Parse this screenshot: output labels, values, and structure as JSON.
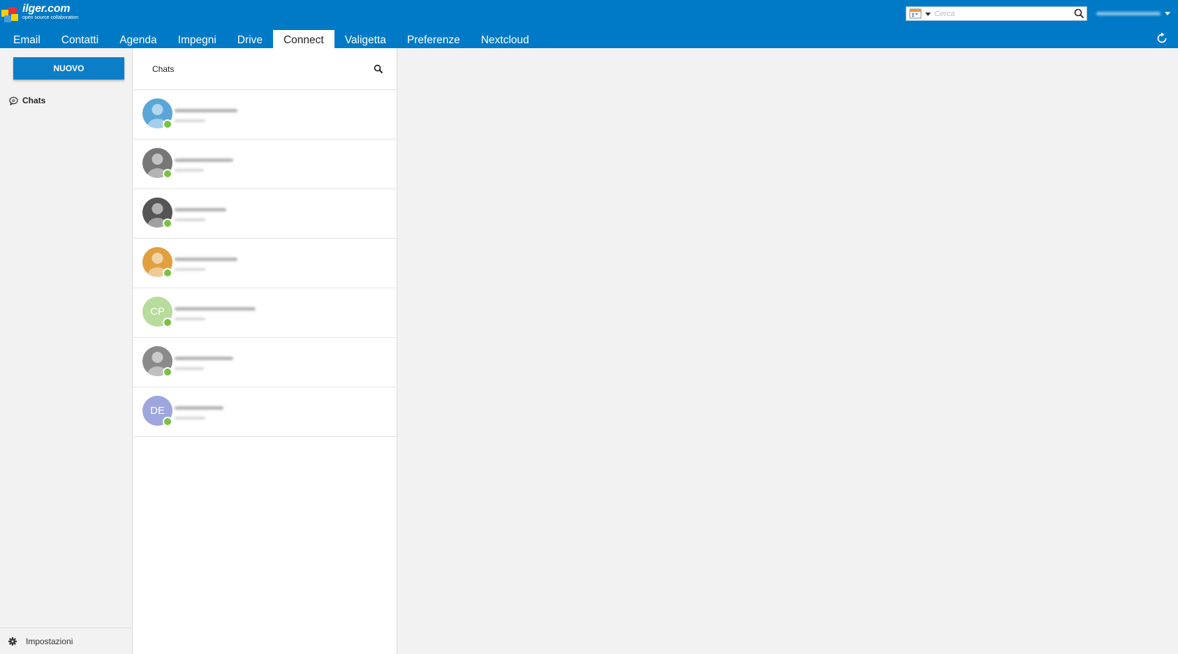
{
  "brand": {
    "name": "ilger.com",
    "tagline": "open source collaboration"
  },
  "search": {
    "placeholder": "Cerca"
  },
  "nav": {
    "tabs": [
      {
        "label": "Email",
        "active": false
      },
      {
        "label": "Contatti",
        "active": false
      },
      {
        "label": "Agenda",
        "active": false
      },
      {
        "label": "Impegni",
        "active": false
      },
      {
        "label": "Drive",
        "active": false
      },
      {
        "label": "Connect",
        "active": true
      },
      {
        "label": "Valigetta",
        "active": false
      },
      {
        "label": "Preferenze",
        "active": false
      },
      {
        "label": "Nextcloud",
        "active": false
      }
    ]
  },
  "sidebar": {
    "new_button": "NUOVO",
    "items": [
      {
        "label": "Chats",
        "icon": "chat-icon"
      }
    ],
    "settings_label": "Impostazioni"
  },
  "chat_list": {
    "title": "Chats",
    "rows": [
      {
        "avatar_type": "photo",
        "avatar_color": "#5aa6d8",
        "status": "online"
      },
      {
        "avatar_type": "photo",
        "avatar_color": "#777777",
        "status": "online"
      },
      {
        "avatar_type": "photo",
        "avatar_color": "#555555",
        "status": "online"
      },
      {
        "avatar_type": "photo",
        "avatar_color": "#e0a040",
        "status": "online"
      },
      {
        "avatar_type": "initials",
        "initials": "CP",
        "avatar_color": "#b8dc9c",
        "status": "online"
      },
      {
        "avatar_type": "photo",
        "avatar_color": "#8a8a8a",
        "status": "online"
      },
      {
        "avatar_type": "initials",
        "initials": "DE",
        "avatar_color": "#9ea6de",
        "status": "online"
      }
    ]
  },
  "colors": {
    "header_blue": "#007ac6",
    "button_blue": "#0c7ec8",
    "status_online": "#7ac142"
  }
}
